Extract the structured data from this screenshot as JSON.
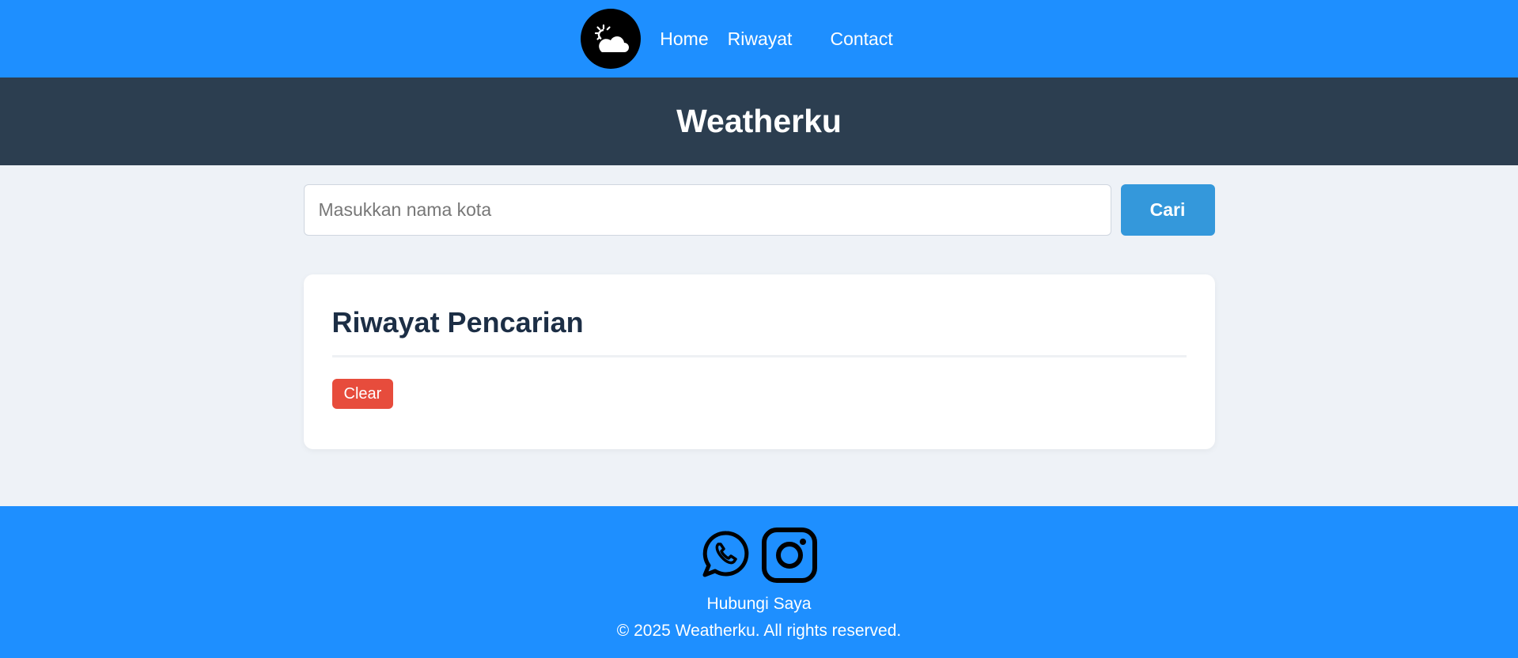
{
  "nav": {
    "logo_icon": "sun-cloud-icon",
    "links": [
      {
        "label": "Home"
      },
      {
        "label": "Riwayat"
      },
      {
        "label": "Contact"
      }
    ]
  },
  "hero": {
    "title": "Weatherku"
  },
  "search": {
    "placeholder": "Masukkan nama kota",
    "value": "",
    "button_label": "Cari"
  },
  "history": {
    "title": "Riwayat Pencarian",
    "clear_label": "Clear"
  },
  "footer": {
    "social_icons": [
      "whatsapp-icon",
      "instagram-icon"
    ],
    "contact_label": "Hubungi Saya",
    "copyright": "© 2025 Weatherku. All rights reserved."
  },
  "colors": {
    "nav_bg": "#1e8fff",
    "hero_bg": "#2c3e50",
    "accent": "#3498db",
    "danger": "#e74c3c"
  }
}
